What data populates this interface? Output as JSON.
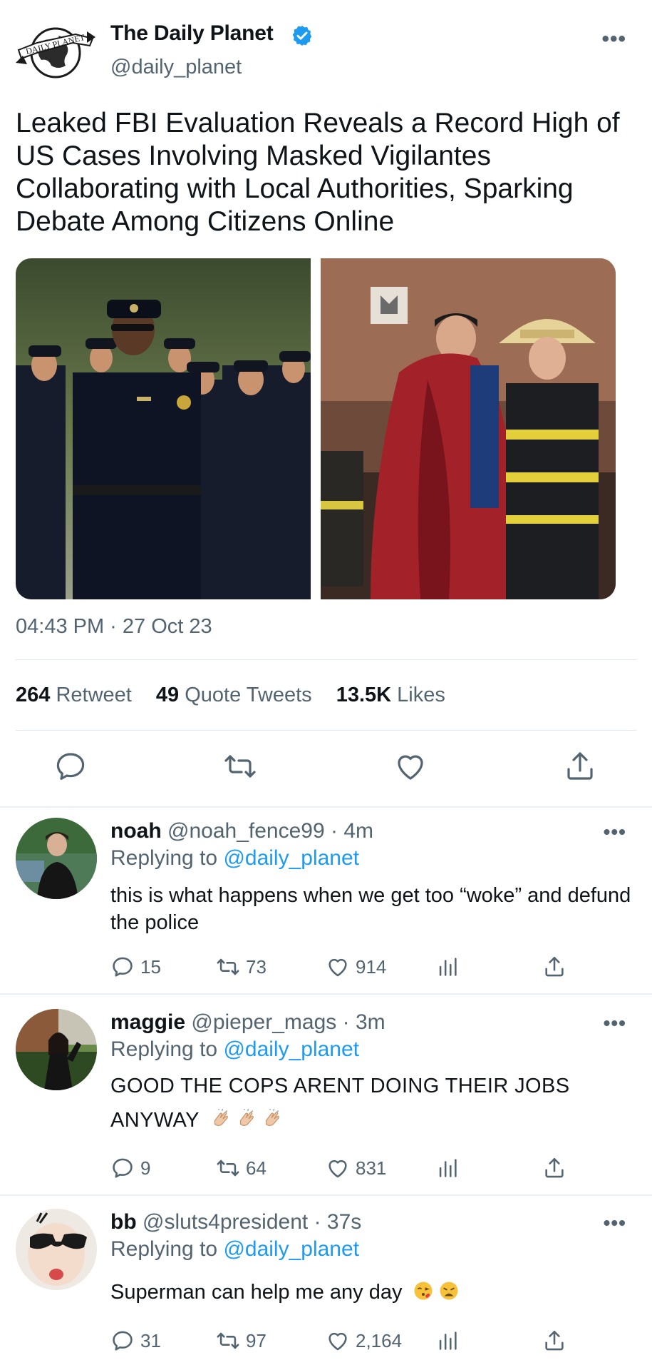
{
  "tweet": {
    "display_name": "The Daily Planet",
    "handle": "@daily_planet",
    "logo_text": "DAILY PLANET",
    "text": "Leaked FBI Evaluation Reveals a Record High of US Cases Involving Masked Vigilantes Collaborating with Local Authorities, Sparking Debate Among Citizens Online",
    "timestamp": "04:43 PM · 27 Oct 23",
    "stats": {
      "retweets_count": "264",
      "retweets_label": "Retweet",
      "quotes_count": "49",
      "quotes_label": "Quote Tweets",
      "likes_count": "13.5K",
      "likes_label": "Likes"
    },
    "more_label": "•••"
  },
  "replies": [
    {
      "name": "noah",
      "handle": "@noah_fence99",
      "time": "· 4m",
      "replying_label": "Replying to",
      "replying_to": "@daily_planet",
      "text": "this is what happens when we get too “woke” and defund the police",
      "replies": "15",
      "retweets": "73",
      "likes": "914"
    },
    {
      "name": "maggie",
      "handle": "@pieper_mags",
      "time": "· 3m",
      "replying_label": "Replying to",
      "replying_to": "@daily_planet",
      "text": "GOOD THE COPS ARENT DOING THEIR JOBS ANYWAY",
      "emojis": [
        "clapping-hands",
        "clapping-hands",
        "clapping-hands"
      ],
      "replies": "9",
      "retweets": "64",
      "likes": "831"
    },
    {
      "name": "bb",
      "handle": "@sluts4president",
      "time": "· 37s",
      "replying_label": "Replying to",
      "replying_to": "@daily_planet",
      "text": "Superman can help me any day",
      "emojis": [
        "face-blowing-kiss",
        "weary-face"
      ],
      "replies": "31",
      "retweets": "97",
      "likes": "2,164"
    }
  ],
  "colors": {
    "link": "#1d9bf0",
    "muted": "#536471",
    "text": "#0f1419",
    "verified": "#1d9bf0"
  }
}
